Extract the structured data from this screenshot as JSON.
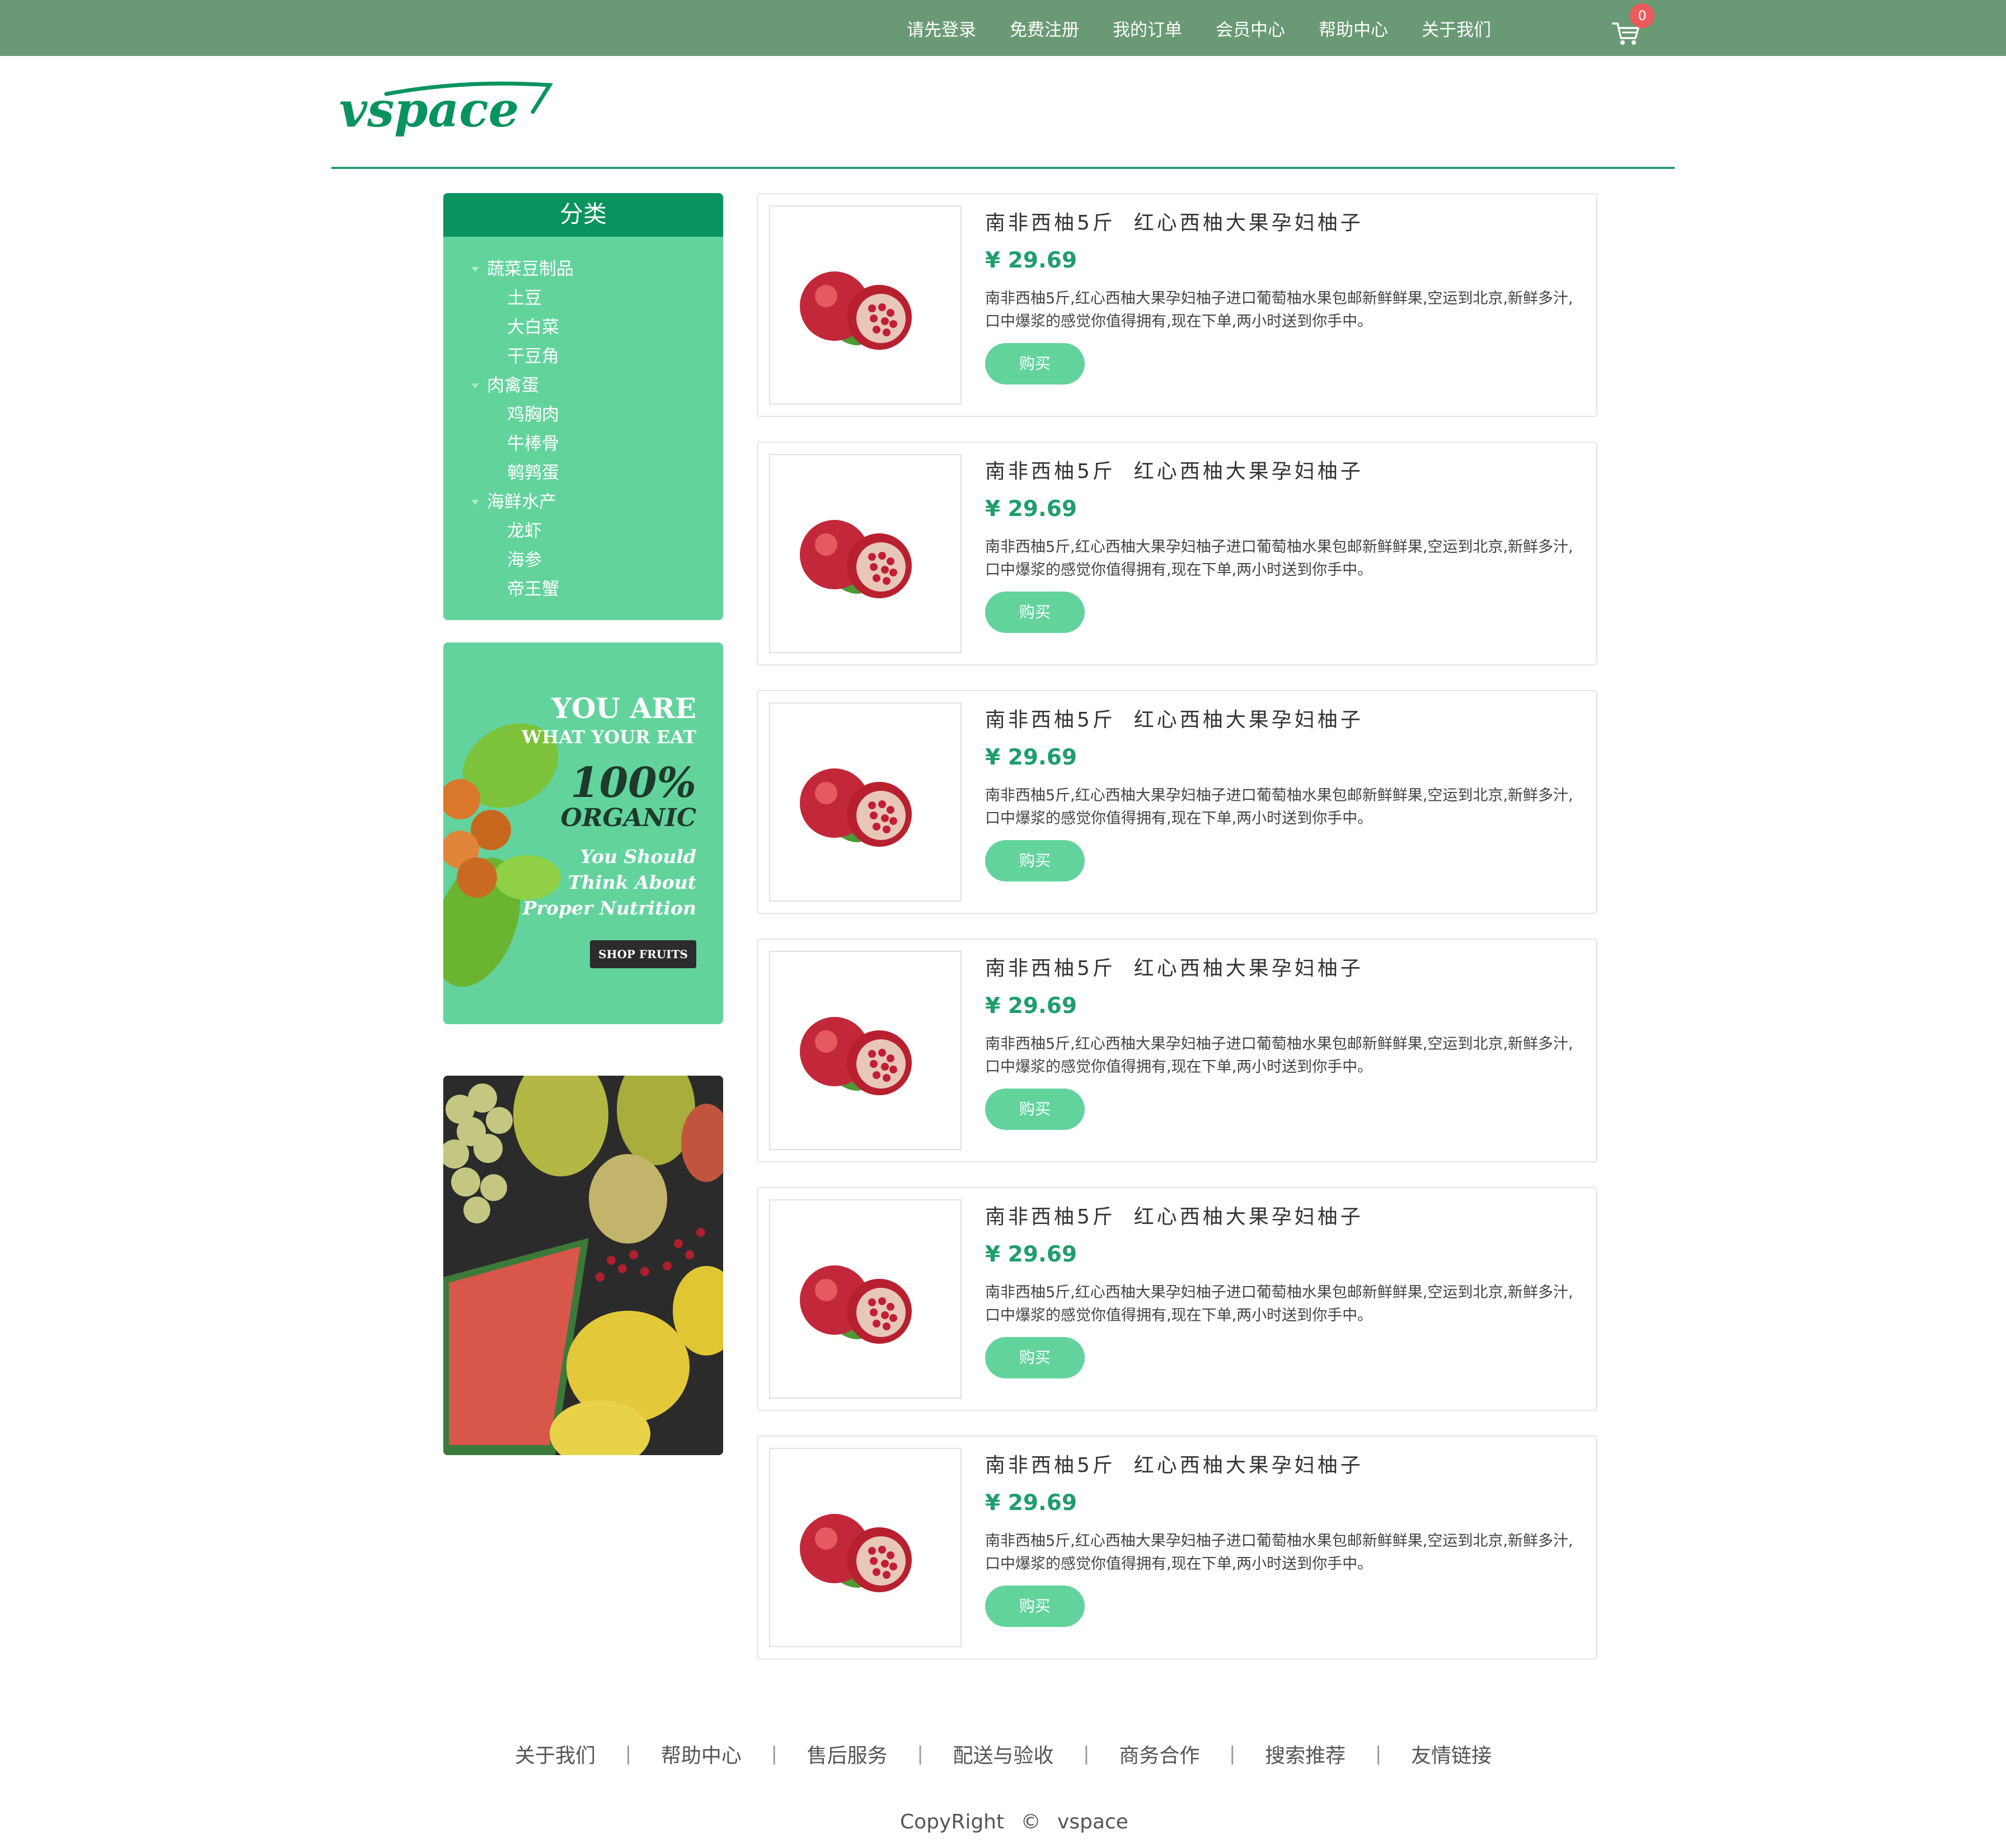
{
  "top_nav": {
    "items": [
      "请先登录",
      "免费注册",
      "我的订单",
      "会员中心",
      "帮助中心",
      "关于我们"
    ],
    "cart_count": "0",
    "cart_icon": "cart-icon"
  },
  "brand": {
    "logo_text": "vspace",
    "color": "#08935f"
  },
  "colors": {
    "topbar": "#699a75",
    "accent": "#63d39d",
    "accent_dark": "#08935f",
    "price": "#1f9d6e"
  },
  "sidebar": {
    "category_title": "分类",
    "groups": [
      {
        "name": "蔬菜豆制品",
        "items": [
          "土豆",
          "大白菜",
          "干豆角"
        ]
      },
      {
        "name": "肉禽蛋",
        "items": [
          "鸡胸肉",
          "牛棒骨",
          "鹌鹑蛋"
        ]
      },
      {
        "name": "海鲜水产",
        "items": [
          "龙虾",
          "海参",
          "帝王蟹"
        ]
      }
    ]
  },
  "promo": {
    "line1": "YOU ARE",
    "line2": "WHAT YOUR EAT",
    "line3": "100%",
    "line4": "ORGANIC",
    "line5": "You Should Think About Proper Nutrition",
    "button": "SHOP FRUITS"
  },
  "products": [
    {
      "title": "南非西柚5斤  红心西柚大果孕妇柚子",
      "price": "¥ 29.69",
      "desc": "南非西柚5斤,红心西柚大果孕妇柚子进口葡萄柚水果包邮新鲜鲜果,空运到北京,新鲜多汁,口中爆浆的感觉你值得拥有,现在下单,两小时送到你手中。",
      "buy": "购买"
    },
    {
      "title": "南非西柚5斤  红心西柚大果孕妇柚子",
      "price": "¥ 29.69",
      "desc": "南非西柚5斤,红心西柚大果孕妇柚子进口葡萄柚水果包邮新鲜鲜果,空运到北京,新鲜多汁,口中爆浆的感觉你值得拥有,现在下单,两小时送到你手中。",
      "buy": "购买"
    },
    {
      "title": "南非西柚5斤  红心西柚大果孕妇柚子",
      "price": "¥ 29.69",
      "desc": "南非西柚5斤,红心西柚大果孕妇柚子进口葡萄柚水果包邮新鲜鲜果,空运到北京,新鲜多汁,口中爆浆的感觉你值得拥有,现在下单,两小时送到你手中。",
      "buy": "购买"
    },
    {
      "title": "南非西柚5斤  红心西柚大果孕妇柚子",
      "price": "¥ 29.69",
      "desc": "南非西柚5斤,红心西柚大果孕妇柚子进口葡萄柚水果包邮新鲜鲜果,空运到北京,新鲜多汁,口中爆浆的感觉你值得拥有,现在下单,两小时送到你手中。",
      "buy": "购买"
    },
    {
      "title": "南非西柚5斤  红心西柚大果孕妇柚子",
      "price": "¥ 29.69",
      "desc": "南非西柚5斤,红心西柚大果孕妇柚子进口葡萄柚水果包邮新鲜鲜果,空运到北京,新鲜多汁,口中爆浆的感觉你值得拥有,现在下单,两小时送到你手中。",
      "buy": "购买"
    },
    {
      "title": "南非西柚5斤  红心西柚大果孕妇柚子",
      "price": "¥ 29.69",
      "desc": "南非西柚5斤,红心西柚大果孕妇柚子进口葡萄柚水果包邮新鲜鲜果,空运到北京,新鲜多汁,口中爆浆的感觉你值得拥有,现在下单,两小时送到你手中。",
      "buy": "购买"
    }
  ],
  "footer": {
    "links": [
      "关于我们",
      "帮助中心",
      "售后服务",
      "配送与验收",
      "商务合作",
      "搜索推荐",
      "友情链接"
    ],
    "separator": "|",
    "copyright": [
      "CopyRight",
      "©",
      "vspace"
    ]
  }
}
